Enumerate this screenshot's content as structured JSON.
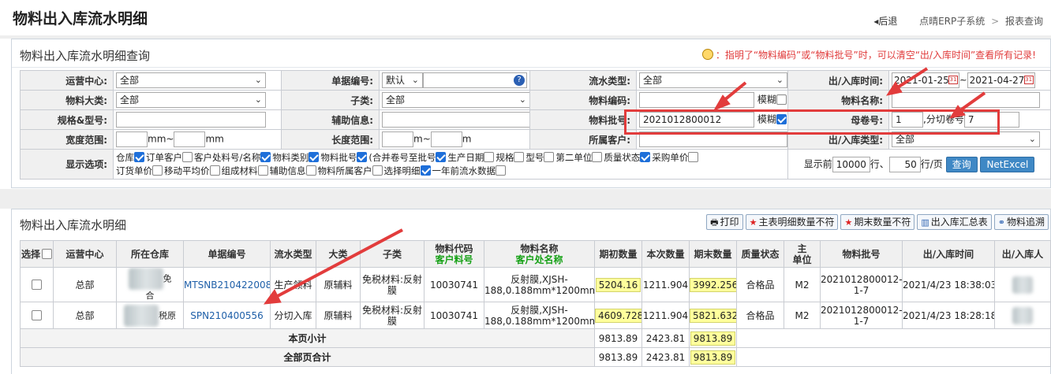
{
  "header": {
    "title": "物料出入库流水明细",
    "back": "后退",
    "crumb1": "点晴ERP子系统",
    "crumb_sep": ">",
    "crumb2": "报表查询"
  },
  "query": {
    "title": "物料出入库流水明细查询",
    "tip": "：指明了“物料编码”或“物料批号”时，可以清空“出/入库时间”查看所有记录!",
    "f_center_label": "运营中心:",
    "f_center_value": "全部",
    "f_docno_label": "单据编号:",
    "f_docno_value": "默认",
    "f_flowtype_label": "流水类型:",
    "f_flowtype_value": "全部",
    "f_time_label": "出/入库时间:",
    "f_time_from": "2021-01-25",
    "f_time_tilde": "~",
    "f_time_to": "2021-04-27",
    "f_cat_label": "物料大类:",
    "f_cat_value": "全部",
    "f_subcat_label": "子类:",
    "f_subcat_value": "全部",
    "f_code_label": "物料编码:",
    "f_code_value": "",
    "fuzzy_label": "模糊",
    "f_name_label": "物料名称:",
    "f_name_value": "",
    "f_spec_label": "规格&型号:",
    "f_spec_value": "",
    "f_aux_label": "辅助信息:",
    "f_aux_value": "",
    "f_batch_label": "物料批号:",
    "f_batch_value": "2021012800012",
    "f_parent_label": "母卷号:",
    "f_parent_value": "1",
    "f_cut_label": ",分切卷号",
    "f_cut_value": "7",
    "f_width_label": "宽度范围:",
    "unit_mm": "mm",
    "tilde": "~",
    "f_len_label": "长度范围:",
    "unit_m": "m",
    "f_customer_label": "所属客户:",
    "f_customer_value": "",
    "f_iotype_label": "出/入库类型:",
    "f_iotype_value": "全部",
    "display_label": "显示选项:",
    "options": [
      {
        "label": "仓库",
        "checked": true
      },
      {
        "label": "订单客户",
        "checked": false
      },
      {
        "label": "客户处料号/名称",
        "checked": true
      },
      {
        "label": "物料类别",
        "checked": true
      },
      {
        "label": "物料批号",
        "checked": true
      },
      {
        "label": "(合并卷号至批号",
        "checked": true
      },
      {
        "label": "生产日期",
        "checked": false
      },
      {
        "label": "规格",
        "checked": false
      },
      {
        "label": "型号",
        "checked": false
      },
      {
        "label": "第二单位",
        "checked": false
      },
      {
        "label": "质量状态",
        "checked": true
      },
      {
        "label": "采购单价",
        "checked": false
      },
      {
        "label": "订货单价",
        "checked": false
      },
      {
        "label": "移动平均价",
        "checked": false
      },
      {
        "label": "组成材料",
        "checked": false
      },
      {
        "label": "辅助信息",
        "checked": false
      },
      {
        "label": "物料所属客户",
        "checked": false
      },
      {
        "label": "选择明细",
        "checked": true
      },
      {
        "label": "一年前流水数据",
        "checked": false
      }
    ],
    "show_front": "显示前",
    "show_count": "10000",
    "rows_label": "行、",
    "per_page": "50",
    "per_page_label": "行/页",
    "query_btn": "查询",
    "export_btn": "NetExcel"
  },
  "result": {
    "title": "物料出入库流水明细",
    "buttons": [
      "打印",
      "主表明细数量不符",
      "期末数量不符",
      "出入库汇总表",
      "物料追溯"
    ],
    "headers": {
      "select": "选择",
      "center": "运营中心",
      "warehouse": "所在仓库",
      "docno": "单据编号",
      "flowtype": "流水类型",
      "cat": "大类",
      "subcat": "子类",
      "code": "物料代码",
      "code_sub": "客户料号",
      "name": "物料名称",
      "name_sub": "客户处名称",
      "qty_begin": "期初数量",
      "qty_this": "本次数量",
      "qty_end": "期末数量",
      "quality": "质量状态",
      "unit_main": "主",
      "unit_sub": "单位",
      "batch": "物料批号",
      "iotime": "出/入库时间",
      "operator": "出/入库人"
    },
    "rows": [
      {
        "center": "总部",
        "warehouse_suffix": "免\n合",
        "docno": "MTSNB210422008",
        "flowtype": "生产领料",
        "cat": "原辅料",
        "subcat": "免税材料:反射膜",
        "code": "10030741",
        "name": "反射膜,XJSH-188,0.188mm*1200mm",
        "qty_begin": "5204.16",
        "qty_this": "1211.904",
        "qty_end": "3992.256",
        "quality": "合格品",
        "unit": "M2",
        "batch": "2021012800012-1-7",
        "iotime": "2021/4/23 18:38:03"
      },
      {
        "center": "总部",
        "warehouse_suffix": "税原",
        "docno": "SPN210400556",
        "flowtype": "分切入库",
        "cat": "原辅料",
        "subcat": "免税材料:反射膜",
        "code": "10030741",
        "name": "反射膜,XJSH-188,0.188mm*1200mm",
        "qty_begin": "4609.728",
        "qty_this": "1211.904",
        "qty_end": "5821.632",
        "quality": "合格品",
        "unit": "M2",
        "batch": "2021012800012-1-7",
        "iotime": "2021/4/23 18:28:18"
      }
    ],
    "page_subtotal_label": "本页小计",
    "page_subtotal": {
      "qty_begin": "9813.89",
      "qty_this": "2423.81",
      "qty_end": "9813.89"
    },
    "all_total_label": "全部页合计",
    "all_total": {
      "qty_begin": "9813.89",
      "qty_this": "2423.81",
      "qty_end": "9813.89"
    }
  },
  "colors": {
    "accent": "#3f88c5",
    "tip": "#e03b3b",
    "annotation": "#e23c3c",
    "highlight": "#ffff9c"
  }
}
